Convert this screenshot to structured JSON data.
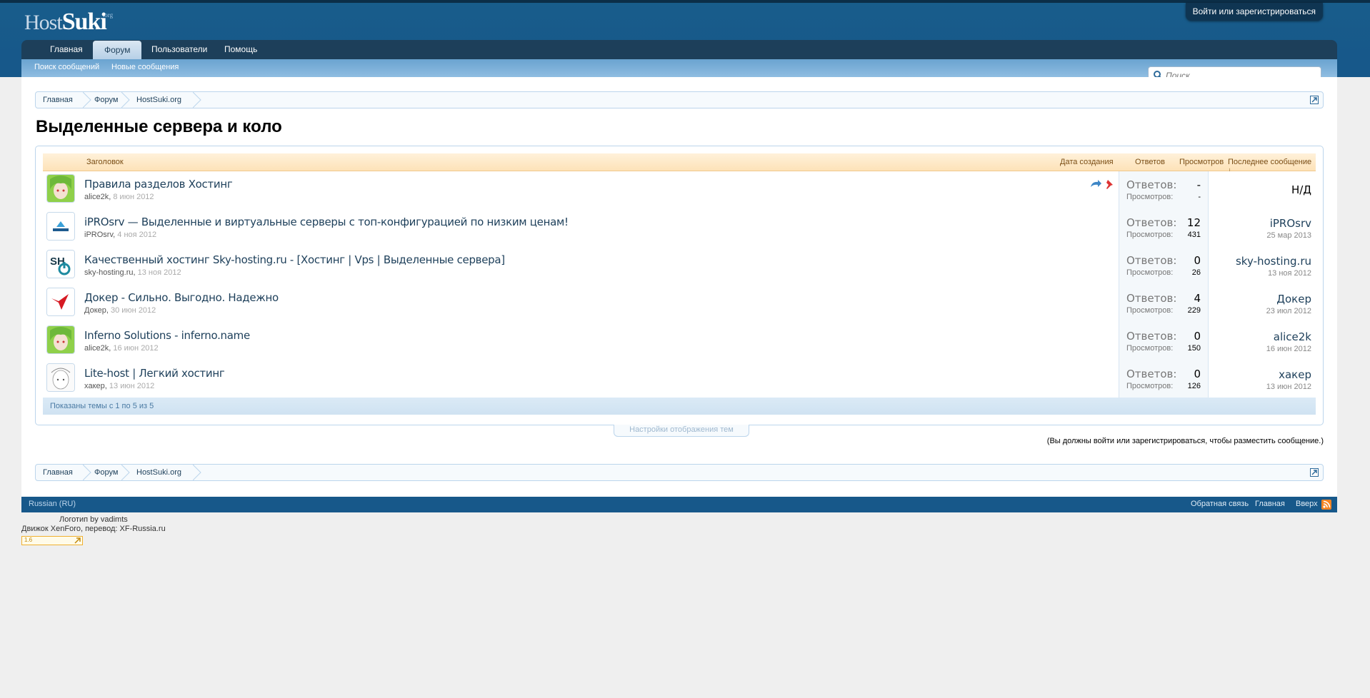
{
  "logo": {
    "host": "Host",
    "suki": "Suki",
    "org": ".org"
  },
  "header": {
    "login_label": "Войти или зарегистрироваться"
  },
  "nav": {
    "tabs": [
      {
        "label": "Главная"
      },
      {
        "label": "Форум"
      },
      {
        "label": "Пользователи"
      },
      {
        "label": "Помощь"
      }
    ],
    "sub": [
      {
        "label": "Поиск сообщений"
      },
      {
        "label": "Новые сообщения"
      }
    ]
  },
  "search": {
    "placeholder": "Поиск..."
  },
  "breadcrumb": {
    "items": [
      "Главная",
      "Форум",
      "HostSuki.org"
    ]
  },
  "page": {
    "title": "Выделенные сервера и коло"
  },
  "table": {
    "headers": {
      "title": "Заголовок",
      "created": "Дата создания",
      "replies": "Ответов",
      "views": "Просмотров",
      "last": "Последнее сообщение ↓"
    },
    "reply_label": "Ответов:",
    "view_label": "Просмотров:",
    "rows": [
      {
        "title": "Правила разделов Хостинг",
        "author": "alice2k",
        "date": "8 июн 2012",
        "replies": "-",
        "views": "-",
        "last_user": "Н/Д",
        "last_date": ""
      },
      {
        "title": "iPROsrv — Выделенные и виртуальные серверы с топ-конфигурацией по низким ценам!",
        "author": "iPROsrv",
        "date": "4 ноя 2012",
        "replies": "12",
        "views": "431",
        "last_user": "iPROsrv",
        "last_date": "25 мар 2013"
      },
      {
        "title": "Качественный хостинг Sky-hosting.ru - [Хостинг | Vps | Выделенные сервера]",
        "author": "sky-hosting.ru",
        "date": "13 ноя 2012",
        "replies": "0",
        "views": "26",
        "last_user": "sky-hosting.ru",
        "last_date": "13 ноя 2012"
      },
      {
        "title": "Докер - Сильно. Выгодно. Надежно",
        "author": "Докер",
        "date": "30 июн 2012",
        "replies": "4",
        "views": "229",
        "last_user": "Докер",
        "last_date": "23 июл 2012"
      },
      {
        "title": "Inferno Solutions - inferno.name",
        "author": "alice2k",
        "date": "16 июн 2012",
        "replies": "0",
        "views": "150",
        "last_user": "alice2k",
        "last_date": "16 июн 2012"
      },
      {
        "title": "Lite-host | Легкий хостинг",
        "author": "xакер",
        "date": "13 июн 2012",
        "replies": "0",
        "views": "126",
        "last_user": "xакер",
        "last_date": "13 июн 2012"
      }
    ],
    "footer": "Показаны темы с 1 по 5 из 5"
  },
  "display_options": "Настройки отображения тем",
  "login_note": "(Вы должны войти или зарегистрироваться, чтобы разместить сообщение.)",
  "footer": {
    "language": "Russian (RU)",
    "links": [
      "Обратная связь",
      "Главная",
      "Вверх"
    ]
  },
  "credits": {
    "logo": "Логотип by vadimts",
    "engine": "Движок XenForo, перевод: XF-Russia.ru",
    "badge": "1.6"
  },
  "colors": {
    "header": "#185d8b",
    "nav": "#1d3f5a",
    "accent": "#fde2b8",
    "rss": "#f78422"
  }
}
